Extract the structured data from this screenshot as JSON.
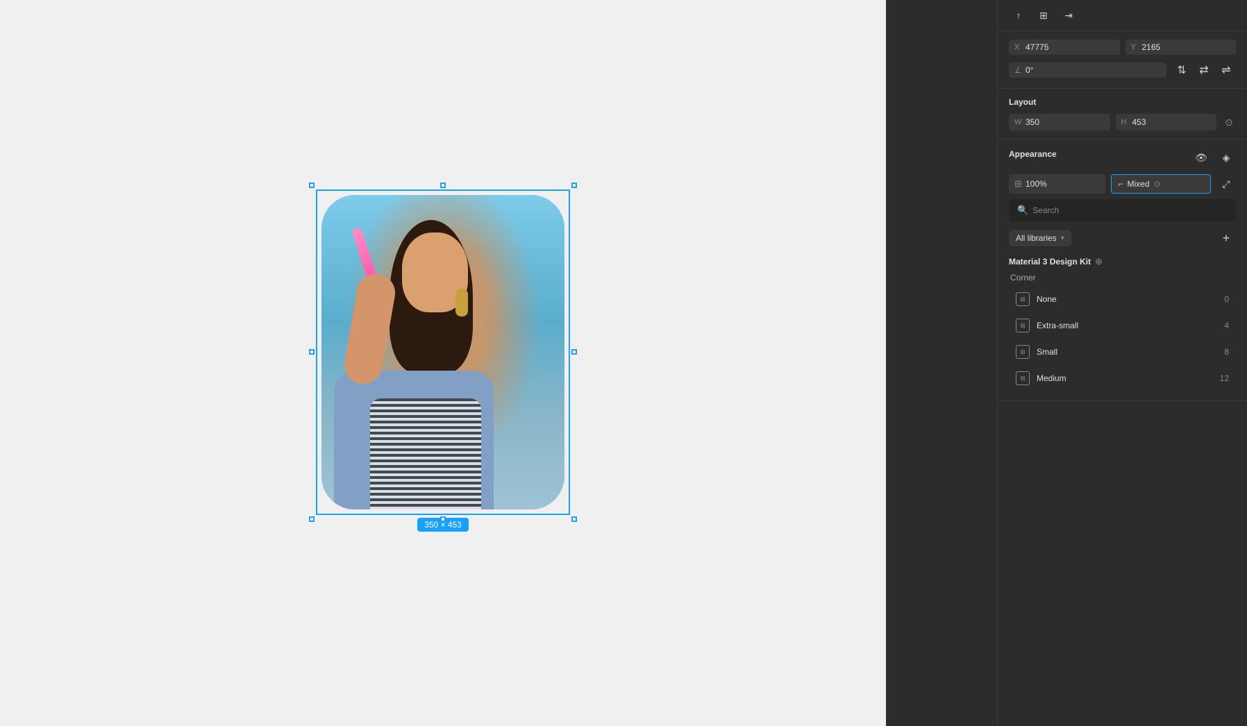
{
  "canvas": {
    "background": "#f0f0f0",
    "image_dimension_label": "350 × 453"
  },
  "right_panel": {
    "toolbar": {
      "icon1": "↑",
      "icon2": "⊞",
      "icon3": "⇥"
    },
    "position": {
      "x_label": "X",
      "x_value": "47775",
      "y_label": "Y",
      "y_value": "2165"
    },
    "rotation": {
      "angle_label": "∠",
      "angle_value": "0°"
    },
    "layout": {
      "title": "Layout",
      "w_label": "W",
      "w_value": "350",
      "h_label": "H",
      "h_value": "453"
    },
    "appearance": {
      "title": "Appearance",
      "opacity_value": "100%",
      "mixed_label": "Mixed",
      "search_placeholder": "Search"
    },
    "libraries": {
      "dropdown_label": "All libraries",
      "chevron": "▾",
      "add_icon": "+"
    },
    "material_kit": {
      "name": "Material 3 Design Kit",
      "globe_icon": "⊕",
      "subsection_label": "Corner",
      "items": [
        {
          "name": "None",
          "value": "0"
        },
        {
          "name": "Extra-small",
          "value": "4"
        },
        {
          "name": "Small",
          "value": "8"
        },
        {
          "name": "Medium",
          "value": "12"
        }
      ]
    }
  }
}
